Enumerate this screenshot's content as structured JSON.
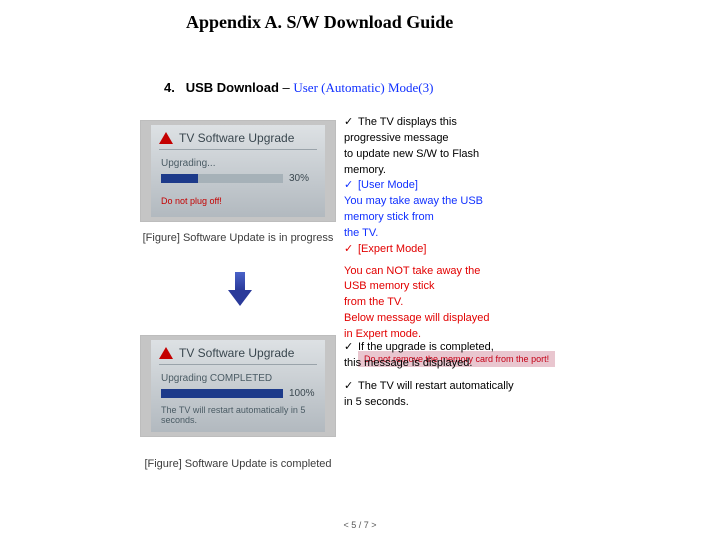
{
  "appendix_title": "Appendix A. S/W Download Guide",
  "section": {
    "number": "4.",
    "title_black": "USB Download",
    "dash": " – ",
    "title_blue": "User (Automatic) Mode(3)"
  },
  "figure1": {
    "header": "TV Software Upgrade",
    "status": "Upgrading...",
    "percent": "30%",
    "fill_pct": 30,
    "warn": "Do not plug off!",
    "caption": "[Figure] Software Update is in progress"
  },
  "figure2": {
    "header": "TV Software Upgrade",
    "status": "Upgrading COMPLETED",
    "percent": "100%",
    "fill_pct": 100,
    "sub": "The TV will restart automatically in 5 seconds.",
    "caption": "[Figure] Software Update is completed"
  },
  "right1": {
    "check": "✓",
    "l1a": "The TV displays this",
    "l1b": "progressive message",
    "l1c": "to update new S/W to Flash",
    "l1d": "memory.",
    "l2a": "[User Mode]",
    "l2b": "You may take away the USB",
    "l2c": "memory stick from",
    "l2d": "the TV.",
    "l3a": "[Expert Mode]",
    "l3b": "You can NOT take away the",
    "l3c": "USB memory stick",
    "l3d": "from the TV.",
    "l3e": "Below message will displayed",
    "l3f": "in Expert mode.",
    "redbox": "Do not remove the memory card from the port!"
  },
  "right2": {
    "check": "✓",
    "l1a": "If the upgrade is completed,",
    "l1b": "this message is displayed.",
    "l2a": "The TV will restart automatically",
    "l2b": "in 5 seconds."
  },
  "page_number": "< 5 / 7 >"
}
